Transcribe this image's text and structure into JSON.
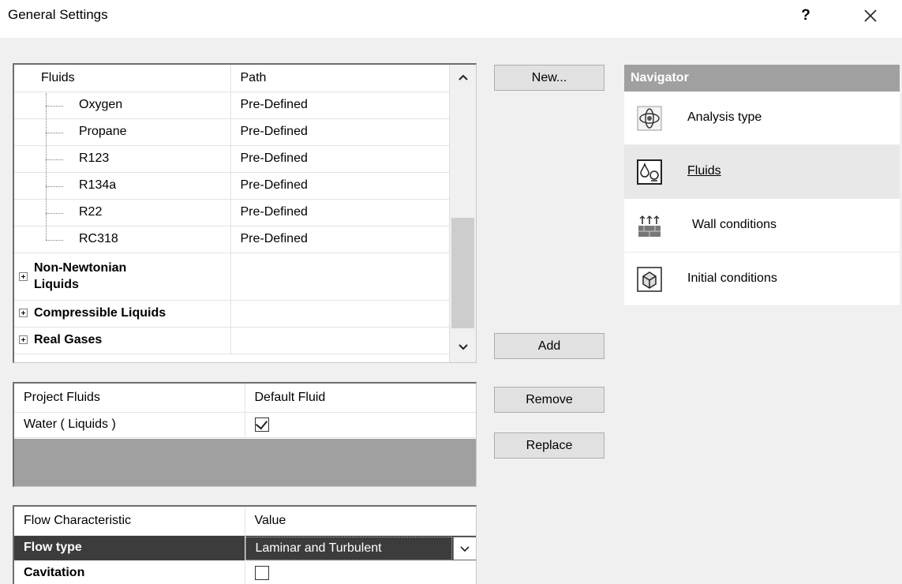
{
  "window": {
    "title": "General Settings",
    "help_label": "?"
  },
  "fluids_tree": {
    "headers": {
      "col1": "Fluids",
      "col2": "Path"
    },
    "items": [
      {
        "name": "Oxygen",
        "path": "Pre-Defined"
      },
      {
        "name": "Propane",
        "path": "Pre-Defined"
      },
      {
        "name": "R123",
        "path": "Pre-Defined"
      },
      {
        "name": "R134a",
        "path": "Pre-Defined"
      },
      {
        "name": "R22",
        "path": "Pre-Defined"
      },
      {
        "name": "RC318",
        "path": "Pre-Defined"
      }
    ],
    "groups": [
      {
        "line1": "Non-Newtonian",
        "line2": "Liquids"
      },
      {
        "label": "Compressible Liquids"
      },
      {
        "label": "Real Gases"
      }
    ]
  },
  "buttons": {
    "new": "New...",
    "add": "Add",
    "remove": "Remove",
    "replace": "Replace"
  },
  "project_fluids": {
    "headers": {
      "col1": "Project Fluids",
      "col2": "Default Fluid"
    },
    "rows": [
      {
        "name": "Water ( Liquids )",
        "default": true
      }
    ]
  },
  "flow": {
    "headers": {
      "col1": "Flow Characteristic",
      "col2": "Value"
    },
    "rows": [
      {
        "label": "Flow type",
        "value": "Laminar and Turbulent"
      },
      {
        "label": "Cavitation",
        "value": ""
      }
    ],
    "cavitation_checked": false
  },
  "navigator": {
    "header": "Navigator",
    "items": [
      {
        "label": "Analysis type",
        "icon": "analysis-type-icon"
      },
      {
        "label": "Fluids",
        "icon": "fluids-icon"
      },
      {
        "label": "Wall conditions",
        "icon": "wall-conditions-icon"
      },
      {
        "label": "Initial conditions",
        "icon": "initial-conditions-icon"
      }
    ],
    "selected": "Fluids"
  },
  "colors": {
    "dialog_bg": "#f0f0f0",
    "selected_row_bg": "#3c3c3c",
    "navigator_header_bg": "#a0a0a0",
    "empty_area_bg": "#a0a0a0"
  }
}
